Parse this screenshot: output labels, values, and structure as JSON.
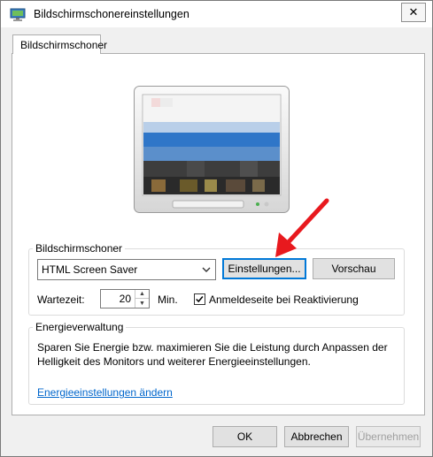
{
  "window": {
    "title": "Bildschirmschonereinstellungen",
    "close": "✕"
  },
  "tab": {
    "label": "Bildschirmschoner"
  },
  "screensaver": {
    "group_label": "Bildschirmschoner",
    "selected": "HTML Screen Saver",
    "settings_label": "Einstellungen...",
    "preview_label": "Vorschau",
    "wait_label": "Wartezeit:",
    "wait_value": "20",
    "wait_unit": "Min.",
    "logon_checked": true,
    "logon_label": "Anmeldeseite bei Reaktivierung"
  },
  "energy": {
    "group_label": "Energieverwaltung",
    "description": "Sparen Sie Energie bzw. maximieren Sie die Leistung durch Anpassen der Helligkeit des Monitors und weiterer Energieeinstellungen.",
    "link": "Energieeinstellungen ändern"
  },
  "buttons": {
    "ok": "OK",
    "cancel": "Abbrechen",
    "apply": "Übernehmen"
  },
  "colors": {
    "accent": "#0078d7",
    "link": "#0066cc",
    "annotation_arrow": "#e8191e"
  }
}
